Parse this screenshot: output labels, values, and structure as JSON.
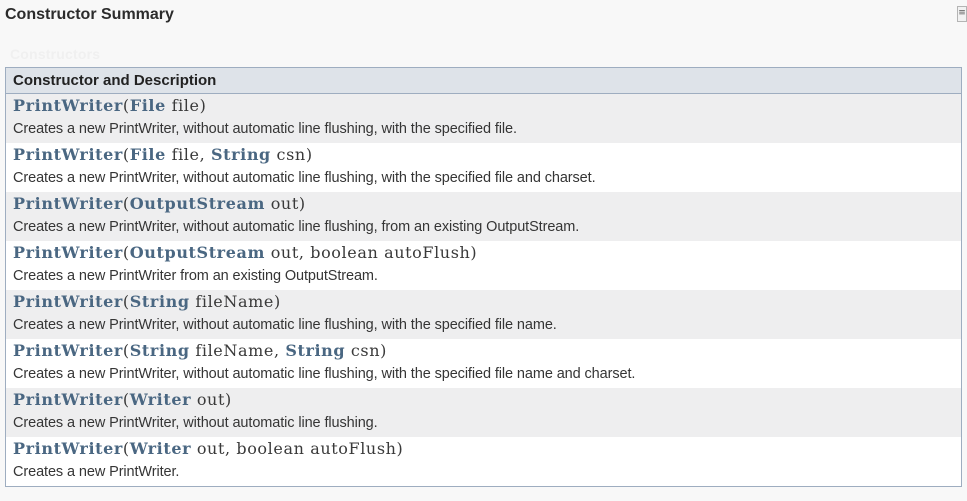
{
  "summary_title": "Constructor Summary",
  "caption": "Constructors",
  "table_header": "Constructor and Description",
  "scroll_glyph": "≡",
  "constructors": [
    {
      "name": "PrintWriter",
      "params": [
        {
          "type": "File",
          "name": "file"
        }
      ],
      "description": "Creates a new PrintWriter, without automatic line flushing, with the specified file."
    },
    {
      "name": "PrintWriter",
      "params": [
        {
          "type": "File",
          "name": "file"
        },
        {
          "type": "String",
          "name": "csn"
        }
      ],
      "description": "Creates a new PrintWriter, without automatic line flushing, with the specified file and charset."
    },
    {
      "name": "PrintWriter",
      "params": [
        {
          "type": "OutputStream",
          "name": "out"
        }
      ],
      "description": "Creates a new PrintWriter, without automatic line flushing, from an existing OutputStream."
    },
    {
      "name": "PrintWriter",
      "params": [
        {
          "type": "OutputStream",
          "name": "out"
        },
        {
          "type": "boolean",
          "plain": true,
          "name": "autoFlush"
        }
      ],
      "description": "Creates a new PrintWriter from an existing OutputStream."
    },
    {
      "name": "PrintWriter",
      "params": [
        {
          "type": "String",
          "name": "fileName"
        }
      ],
      "description": "Creates a new PrintWriter, without automatic line flushing, with the specified file name."
    },
    {
      "name": "PrintWriter",
      "params": [
        {
          "type": "String",
          "name": "fileName"
        },
        {
          "type": "String",
          "name": "csn"
        }
      ],
      "description": "Creates a new PrintWriter, without automatic line flushing, with the specified file name and charset."
    },
    {
      "name": "PrintWriter",
      "params": [
        {
          "type": "Writer",
          "name": "out"
        }
      ],
      "description": "Creates a new PrintWriter, without automatic line flushing."
    },
    {
      "name": "PrintWriter",
      "params": [
        {
          "type": "Writer",
          "name": "out"
        },
        {
          "type": "boolean",
          "plain": true,
          "name": "autoFlush"
        }
      ],
      "description": "Creates a new PrintWriter."
    }
  ]
}
